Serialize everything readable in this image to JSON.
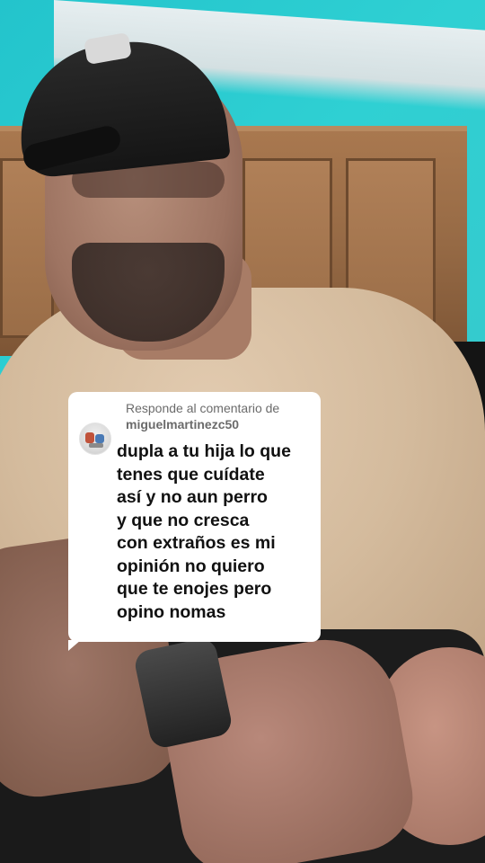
{
  "reply_sticker": {
    "header": "Responde al comentario de",
    "username": "miguelmartinezc50",
    "comment": "dupla a tu hija lo que\ntenes que cuídate\nasí y no aun perro\ny que no cresca\ncon extraños es mi\nopinión no quiero\nque te enojes pero\nopino nomas"
  },
  "colors": {
    "card_background": "#ffffff",
    "header_text": "#6b6b6b",
    "comment_text": "#111111",
    "wall": "#2fd0d3"
  },
  "icons": {
    "avatar": "commenter-avatar"
  }
}
